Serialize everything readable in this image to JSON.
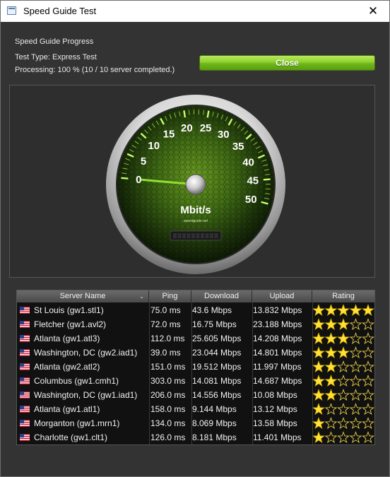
{
  "window": {
    "title": "Speed Guide Test",
    "close_glyph": "✕"
  },
  "progress": {
    "heading": "Speed Guide Progress",
    "test_type": "Test Type: Express Test",
    "processing": "Processing: 100 % (10 / 10 server completed.)"
  },
  "close_button": "Close",
  "gauge": {
    "unit": "Mbit/s",
    "brand": "speedguide.net",
    "ticks": [
      "0",
      "5",
      "10",
      "15",
      "20",
      "25",
      "30",
      "35",
      "40",
      "45",
      "50"
    ],
    "needle_value": 0
  },
  "table": {
    "columns": [
      "Server Name",
      "Ping",
      "Download",
      "Upload",
      "Rating"
    ],
    "rows": [
      {
        "server": "St Louis (gw1.stl1)",
        "ping": "75.0 ms",
        "download": "43.6 Mbps",
        "upload": "13.832 Mbps",
        "rating": 5
      },
      {
        "server": "Fletcher (gw1.avl2)",
        "ping": "72.0 ms",
        "download": "16.75 Mbps",
        "upload": "23.188 Mbps",
        "rating": 3
      },
      {
        "server": "Atlanta (gw1.atl3)",
        "ping": "112.0 ms",
        "download": "25.605 Mbps",
        "upload": "14.208 Mbps",
        "rating": 3
      },
      {
        "server": "Washington, DC (gw2.iad1)",
        "ping": "39.0 ms",
        "download": "23.044 Mbps",
        "upload": "14.801 Mbps",
        "rating": 3
      },
      {
        "server": "Atlanta (gw2.atl2)",
        "ping": "151.0 ms",
        "download": "19.512 Mbps",
        "upload": "11.997 Mbps",
        "rating": 2
      },
      {
        "server": "Columbus (gw1.cmh1)",
        "ping": "303.0 ms",
        "download": "14.081 Mbps",
        "upload": "14.687 Mbps",
        "rating": 2
      },
      {
        "server": "Washington, DC (gw1.iad1)",
        "ping": "206.0 ms",
        "download": "14.556 Mbps",
        "upload": "10.08 Mbps",
        "rating": 2
      },
      {
        "server": "Atlanta (gw1.atl1)",
        "ping": "158.0 ms",
        "download": "9.144 Mbps",
        "upload": "13.12 Mbps",
        "rating": 1
      },
      {
        "server": "Morganton (gw1.mrn1)",
        "ping": "134.0 ms",
        "download": "8.069 Mbps",
        "upload": "13.58 Mbps",
        "rating": 1
      },
      {
        "server": "Charlotte (gw1.clt1)",
        "ping": "126.0 ms",
        "download": "8.181 Mbps",
        "upload": "11.401 Mbps",
        "rating": 1
      }
    ]
  }
}
